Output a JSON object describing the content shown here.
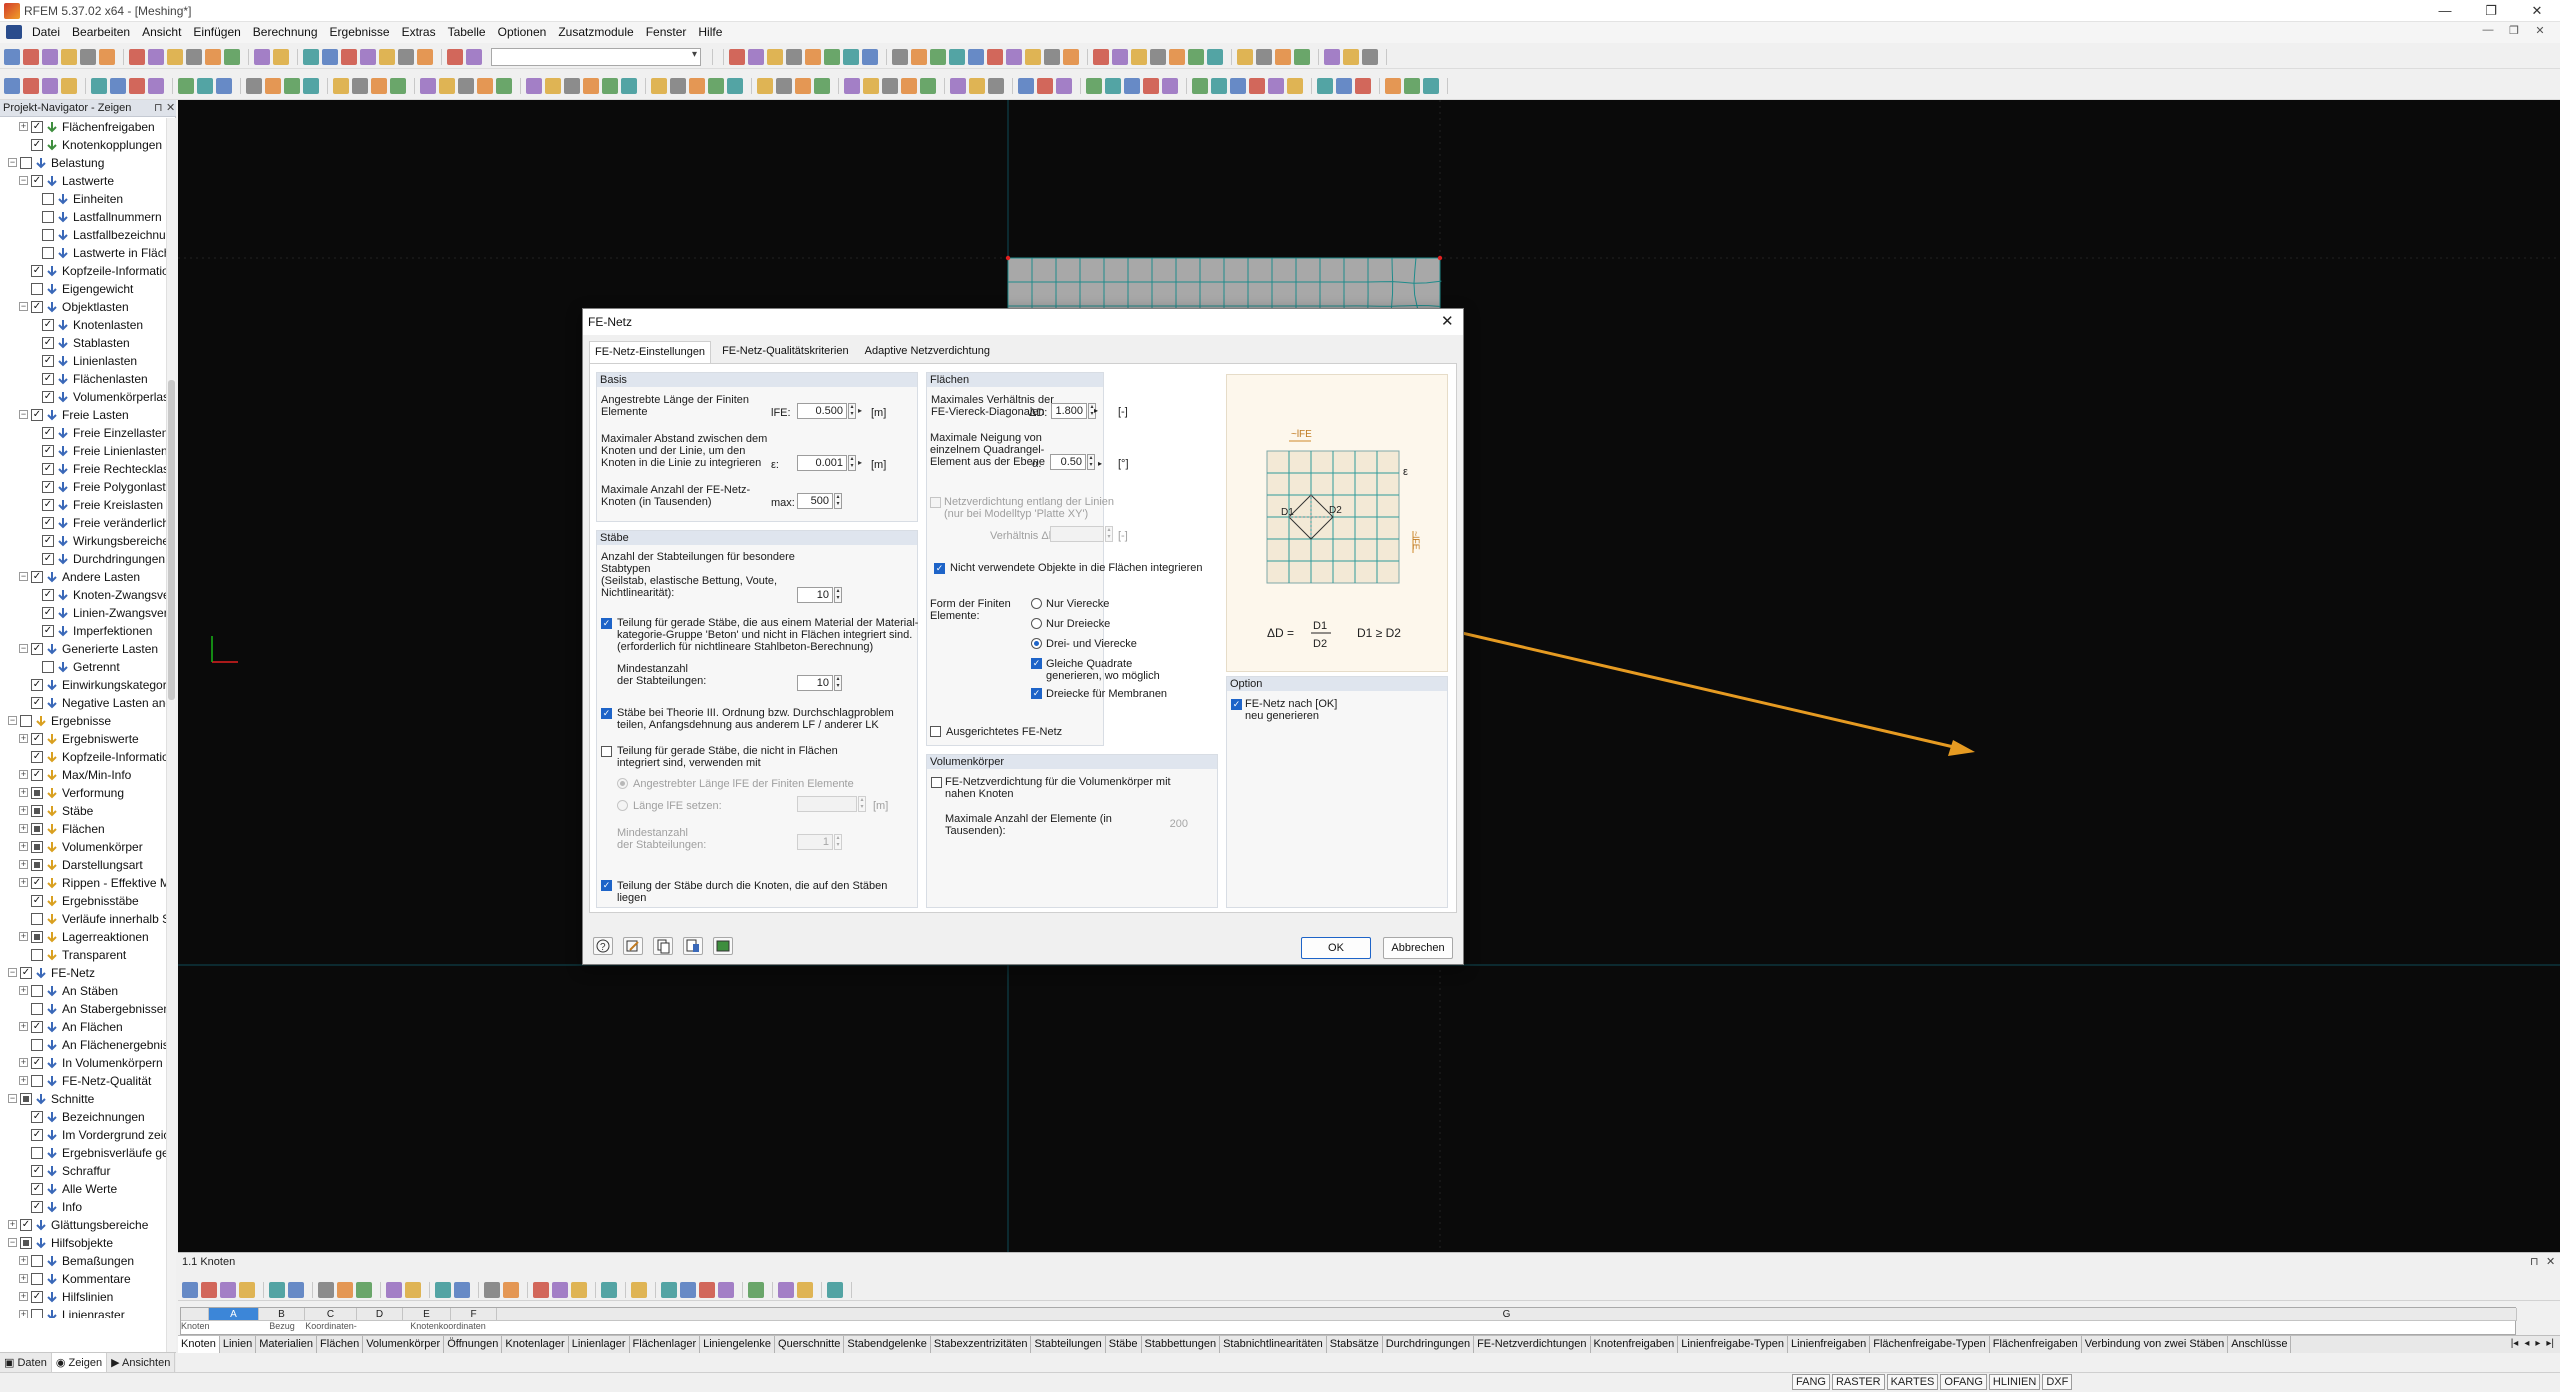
{
  "window": {
    "title": "RFEM 5.37.02 x64 - [Meshing*]",
    "controls": [
      "—",
      "❐",
      "✕"
    ]
  },
  "menu": {
    "items": [
      "Datei",
      "Bearbeiten",
      "Ansicht",
      "Einfügen",
      "Berechnung",
      "Ergebnisse",
      "Extras",
      "Tabelle",
      "Optionen",
      "Zusatzmodule",
      "Fenster",
      "Hilfe"
    ],
    "mdi_controls": [
      "—",
      "❐",
      "✕"
    ]
  },
  "navigator": {
    "title": "Projekt-Navigator - Zeigen",
    "controls": [
      "⊓",
      "✕"
    ],
    "tabs": [
      "Daten",
      "Zeigen",
      "Ansichten"
    ],
    "rows": [
      {
        "d": 1,
        "e": "+",
        "c": "✓",
        "i": "#3e8e3e",
        "t": "Flächenfreigaben"
      },
      {
        "d": 1,
        "e": "",
        "c": "✓",
        "i": "#3e8e3e",
        "t": "Knotenkopplungen"
      },
      {
        "d": 0,
        "e": "−",
        "c": "",
        "i": "#3a68b8",
        "t": "Belastung"
      },
      {
        "d": 1,
        "e": "−",
        "c": "✓",
        "i": "#3a68b8",
        "t": "Lastwerte"
      },
      {
        "d": 2,
        "e": "",
        "c": "",
        "i": "#3a68b8",
        "t": "Einheiten"
      },
      {
        "d": 2,
        "e": "",
        "c": "",
        "i": "#3a68b8",
        "t": "Lastfallnummern"
      },
      {
        "d": 2,
        "e": "",
        "c": "",
        "i": "#3a68b8",
        "t": "Lastfallbezeichnungen"
      },
      {
        "d": 2,
        "e": "",
        "c": "",
        "i": "#3a68b8",
        "t": "Lastwerte in Flächenmitte anzei"
      },
      {
        "d": 1,
        "e": "",
        "c": "✓",
        "i": "#3a68b8",
        "t": "Kopfzeile-Information"
      },
      {
        "d": 1,
        "e": "",
        "c": "",
        "i": "#3a68b8",
        "t": "Eigengewicht"
      },
      {
        "d": 1,
        "e": "−",
        "c": "✓",
        "i": "#3a68b8",
        "t": "Objektlasten"
      },
      {
        "d": 2,
        "e": "",
        "c": "✓",
        "i": "#3a68b8",
        "t": "Knotenlasten"
      },
      {
        "d": 2,
        "e": "",
        "c": "✓",
        "i": "#3a68b8",
        "t": "Stablasten"
      },
      {
        "d": 2,
        "e": "",
        "c": "✓",
        "i": "#3a68b8",
        "t": "Linienlasten"
      },
      {
        "d": 2,
        "e": "",
        "c": "✓",
        "i": "#3a68b8",
        "t": "Flächenlasten"
      },
      {
        "d": 2,
        "e": "",
        "c": "✓",
        "i": "#3a68b8",
        "t": "Volumenkörperlasten"
      },
      {
        "d": 1,
        "e": "−",
        "c": "✓",
        "i": "#3a68b8",
        "t": "Freie Lasten"
      },
      {
        "d": 2,
        "e": "",
        "c": "✓",
        "i": "#3a68b8",
        "t": "Freie Einzellasten"
      },
      {
        "d": 2,
        "e": "",
        "c": "✓",
        "i": "#3a68b8",
        "t": "Freie Linienlasten"
      },
      {
        "d": 2,
        "e": "",
        "c": "✓",
        "i": "#3a68b8",
        "t": "Freie Rechtecklasten"
      },
      {
        "d": 2,
        "e": "",
        "c": "✓",
        "i": "#3a68b8",
        "t": "Freie Polygonlasten"
      },
      {
        "d": 2,
        "e": "",
        "c": "✓",
        "i": "#3a68b8",
        "t": "Freie Kreislasten"
      },
      {
        "d": 2,
        "e": "",
        "c": "✓",
        "i": "#3a68b8",
        "t": "Freie veränderliche Lasten"
      },
      {
        "d": 2,
        "e": "",
        "c": "✓",
        "i": "#3a68b8",
        "t": "Wirkungsbereiche"
      },
      {
        "d": 2,
        "e": "",
        "c": "✓",
        "i": "#3a68b8",
        "t": "Durchdringungen"
      },
      {
        "d": 1,
        "e": "−",
        "c": "✓",
        "i": "#3a68b8",
        "t": "Andere Lasten"
      },
      {
        "d": 2,
        "e": "",
        "c": "✓",
        "i": "#3a68b8",
        "t": "Knoten-Zwangsverformungen"
      },
      {
        "d": 2,
        "e": "",
        "c": "✓",
        "i": "#3a68b8",
        "t": "Linien-Zwangsverschiebungen"
      },
      {
        "d": 2,
        "e": "",
        "c": "✓",
        "i": "#3a68b8",
        "t": "Imperfektionen"
      },
      {
        "d": 1,
        "e": "−",
        "c": "✓",
        "i": "#3a68b8",
        "t": "Generierte Lasten"
      },
      {
        "d": 2,
        "e": "",
        "c": "",
        "i": "#3a68b8",
        "t": "Getrennt"
      },
      {
        "d": 1,
        "e": "",
        "c": "✓",
        "i": "#3a68b8",
        "t": "Einwirkungskategorie Vorspannung"
      },
      {
        "d": 1,
        "e": "",
        "c": "✓",
        "i": "#3a68b8",
        "t": "Negative Lasten andersfarbig"
      },
      {
        "d": 0,
        "e": "−",
        "c": "",
        "i": "#d9a020",
        "t": "Ergebnisse"
      },
      {
        "d": 1,
        "e": "+",
        "c": "✓",
        "i": "#d9a020",
        "t": "Ergebniswerte"
      },
      {
        "d": 1,
        "e": "",
        "c": "✓",
        "i": "#d9a020",
        "t": "Kopfzeile-Information"
      },
      {
        "d": 1,
        "e": "+",
        "c": "✓",
        "i": "#d9a020",
        "t": "Max/Min-Info"
      },
      {
        "d": 1,
        "e": "+",
        "c": "■",
        "i": "#d9a020",
        "t": "Verformung"
      },
      {
        "d": 1,
        "e": "+",
        "c": "■",
        "i": "#d9a020",
        "t": "Stäbe"
      },
      {
        "d": 1,
        "e": "+",
        "c": "■",
        "i": "#d9a020",
        "t": "Flächen"
      },
      {
        "d": 1,
        "e": "+",
        "c": "■",
        "i": "#d9a020",
        "t": "Volumenkörper"
      },
      {
        "d": 1,
        "e": "+",
        "c": "■",
        "i": "#d9a020",
        "t": "Darstellungsart"
      },
      {
        "d": 1,
        "e": "+",
        "c": "✓",
        "i": "#d9a020",
        "t": "Rippen - Effektive Mitwirkung auf F"
      },
      {
        "d": 1,
        "e": "",
        "c": "✓",
        "i": "#d9a020",
        "t": "Ergebnisstäbe"
      },
      {
        "d": 1,
        "e": "",
        "c": "",
        "i": "#d9a020",
        "t": "Verläufe innerhalb Stützenfläche"
      },
      {
        "d": 1,
        "e": "+",
        "c": "■",
        "i": "#d9a020",
        "t": "Lagerreaktionen"
      },
      {
        "d": 1,
        "e": "",
        "c": "",
        "i": "#d9a020",
        "t": "Transparent"
      },
      {
        "d": 0,
        "e": "−",
        "c": "✓",
        "i": "#3a68b8",
        "t": "FE-Netz"
      },
      {
        "d": 1,
        "e": "+",
        "c": "",
        "i": "#3a68b8",
        "t": "An Stäben"
      },
      {
        "d": 1,
        "e": "",
        "c": "",
        "i": "#3a68b8",
        "t": "An Stabergebnissen"
      },
      {
        "d": 1,
        "e": "+",
        "c": "✓",
        "i": "#3a68b8",
        "t": "An Flächen"
      },
      {
        "d": 1,
        "e": "",
        "c": "",
        "i": "#3a68b8",
        "t": "An Flächenergebnissen"
      },
      {
        "d": 1,
        "e": "+",
        "c": "✓",
        "i": "#3a68b8",
        "t": "In Volumenkörpern"
      },
      {
        "d": 1,
        "e": "+",
        "c": "",
        "i": "#3a68b8",
        "t": "FE-Netz-Qualität"
      },
      {
        "d": 0,
        "e": "−",
        "c": "■",
        "i": "#3a68b8",
        "t": "Schnitte"
      },
      {
        "d": 1,
        "e": "",
        "c": "✓",
        "i": "#3a68b8",
        "t": "Bezeichnungen"
      },
      {
        "d": 1,
        "e": "",
        "c": "✓",
        "i": "#3a68b8",
        "t": "Im Vordergrund zeichnen"
      },
      {
        "d": 1,
        "e": "",
        "c": "",
        "i": "#3a68b8",
        "t": "Ergebnisverläufe gefüllt"
      },
      {
        "d": 1,
        "e": "",
        "c": "✓",
        "i": "#3a68b8",
        "t": "Schraffur"
      },
      {
        "d": 1,
        "e": "",
        "c": "✓",
        "i": "#3a68b8",
        "t": "Alle Werte"
      },
      {
        "d": 1,
        "e": "",
        "c": "✓",
        "i": "#3a68b8",
        "t": "Info"
      },
      {
        "d": 0,
        "e": "+",
        "c": "✓",
        "i": "#3a68b8",
        "t": "Glättungsbereiche"
      },
      {
        "d": 0,
        "e": "−",
        "c": "■",
        "i": "#3a68b8",
        "t": "Hilfsobjekte"
      },
      {
        "d": 1,
        "e": "+",
        "c": "",
        "i": "#3a68b8",
        "t": "Bemaßungen"
      },
      {
        "d": 1,
        "e": "+",
        "c": "",
        "i": "#3a68b8",
        "t": "Kommentare"
      },
      {
        "d": 1,
        "e": "+",
        "c": "✓",
        "i": "#3a68b8",
        "t": "Hilfslinien"
      },
      {
        "d": 1,
        "e": "+",
        "c": "",
        "i": "#3a68b8",
        "t": "Linienraster"
      }
    ]
  },
  "table_panel": {
    "title": "1.1 Knoten",
    "controls": [
      "⊓",
      "✕"
    ],
    "columns": [
      {
        "letter": "",
        "sub": "Knoten"
      },
      {
        "letter": "A",
        "sub": ""
      },
      {
        "letter": "B",
        "sub": "Bezug"
      },
      {
        "letter": "C",
        "sub": "Koordinaten-"
      },
      {
        "letter": "D",
        "sub": ""
      },
      {
        "letter": "E",
        "sub": "Knotenkoordinaten"
      },
      {
        "letter": "F",
        "sub": ""
      },
      {
        "letter": "G",
        "sub": ""
      }
    ],
    "sheets": [
      "Knoten",
      "Linien",
      "Materialien",
      "Flächen",
      "Volumenkörper",
      "Öffnungen",
      "Knotenlager",
      "Linienlager",
      "Flächenlager",
      "Liniengelenke",
      "Querschnitte",
      "Stabendgelenke",
      "Stabexzentrizitäten",
      "Stabteilungen",
      "Stäbe",
      "Stabbettungen",
      "Stabnichtlinearitäten",
      "Stabsätze",
      "Durchdringungen",
      "FE-Netzverdichtungen",
      "Knotenfreigaben",
      "Linienfreigabe-Typen",
      "Linienfreigaben",
      "Flächenfreigabe-Typen",
      "Flächenfreigaben",
      "Verbindung von zwei Stäben",
      "Anschlüsse"
    ],
    "nav_arrows": [
      "|◂",
      "◂",
      "▸",
      "▸|"
    ]
  },
  "statusbar": {
    "toggles": [
      "FANG",
      "RASTER",
      "KARTES",
      "OFANG",
      "HLINIEN",
      "DXF"
    ]
  },
  "dialog": {
    "title": "FE-Netz",
    "close": "✕",
    "tabs": [
      "FE-Netz-Einstellungen",
      "FE-Netz-Qualitätskriterien",
      "Adaptive Netzverdichtung"
    ],
    "basis": {
      "header": "Basis",
      "target_length_label": "Angestrebte Länge der Finiten\nElemente",
      "target_length_sym": "lFE:",
      "target_length_value": "0.500",
      "target_length_unit": "[m]",
      "max_distance_label": "Maximaler Abstand zwischen dem\nKnoten und der Linie, um den\nKnoten in die Linie zu integrieren",
      "max_distance_sym": "ε:",
      "max_distance_value": "0.001",
      "max_distance_unit": "[m]",
      "max_nodes_label": "Maximale Anzahl der FE-Netz-\nKnoten (in Tausenden)",
      "max_nodes_sym": "max:",
      "max_nodes_value": "500"
    },
    "staebe": {
      "header": "Stäbe",
      "divisions_label": "Anzahl der Stabteilungen für besondere\nStabtypen\n(Seilstab, elastische Bettung, Voute,\nNichtlinearität):",
      "divisions_value": "10",
      "straight_division_label": "Teilung für gerade Stäbe, die aus einem Material der Material-\nkategorie-Gruppe 'Beton' und nicht in Flächen integriert sind.\n(erforderlich für nichtlineare Stahlbeton-Berechnung)",
      "min_divisions_label": "Mindestanzahl\nder Stabteilungen:",
      "min_divisions_value": "10",
      "theory3_label": "Stäbe bei Theorie III. Ordnung bzw. Durchschlagproblem\nteilen, Anfangsdehnung aus anderem LF / anderer LK",
      "not_integrated_label": "Teilung für gerade Stäbe, die nicht in Flächen\nintegriert sind, verwenden mit",
      "radio_target_length": "Angestrebter Länge lFE der Finiten Elemente",
      "radio_set_length": "Länge lFE setzen:",
      "set_length_unit": "[m]",
      "min_divisions2_label": "Mindestanzahl\nder Stabteilungen:",
      "min_divisions2_value": "1",
      "nodes_on_members_label": "Teilung der Stäbe durch die Knoten, die auf den Stäben liegen"
    },
    "flaechen": {
      "header": "Flächen",
      "max_ratio_label": "Maximales Verhältnis der\nFE-Viereck-Diagonalen",
      "max_ratio_sym": "ΔD:",
      "max_ratio_value": "1.800",
      "max_ratio_unit": "[-]",
      "max_incline_label": "Maximale Neigung von\neinzelnem Quadrangel-\nElement aus der Ebene",
      "max_incline_sym": "α:",
      "max_incline_value": "0.50",
      "max_incline_unit": "[°]",
      "refinement_label": "Netzverdichtung entlang der Linien\n(nur bei Modelltyp 'Platte XY')",
      "ratio_label": "Verhältnis  Δb:",
      "ratio_unit": "[-]",
      "integrate_unused_label": "Nicht verwendete Objekte in die Flächen integrieren",
      "shape_label": "Form der Finiten\nElemente:",
      "shape_quads": "Nur Vierecke",
      "shape_triangles": "Nur Dreiecke",
      "shape_both": "Drei- und Vierecke",
      "equal_squares": "Gleiche Quadrate\ngenerieren, wo möglich",
      "triangles_membranes": "Dreiecke für Membranen",
      "aligned_mesh": "Ausgerichtetes FE-Netz"
    },
    "figure": {
      "lfe": "~lFE",
      "d1": "D1",
      "d2": "D2",
      "eps": "ε",
      "formula_left": "ΔD =",
      "formula_num": "D1",
      "formula_den": "D2",
      "formula_cond": "D1 ≥ D2"
    },
    "volumen": {
      "header": "Volumenkörper",
      "refine_label": "FE-Netzverdichtung für die Volumenkörper mit\nnahen Knoten",
      "max_elements_label": "Maximale Anzahl der Elemente (in\nTausenden):",
      "max_elements_value": "200"
    },
    "option": {
      "header": "Option",
      "regenerate_label": "FE-Netz nach [OK]\nneu generieren"
    },
    "buttons": {
      "ok": "OK",
      "cancel": "Abbrechen"
    }
  },
  "colors": {
    "viewport_bg": "#0a0a0a",
    "mesh_fill": "#a8a8a8",
    "mesh_line": "#1f8b8b",
    "highlight": "#e69b22",
    "checkbox_on": "#1e64c8"
  }
}
